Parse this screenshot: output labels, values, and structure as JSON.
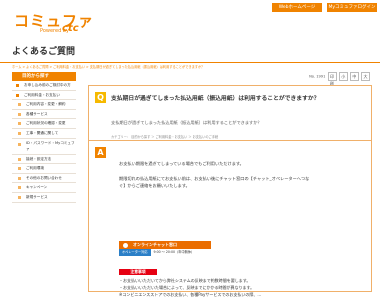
{
  "header": {
    "logo": "コミュファ",
    "logo_sub": "Powered by",
    "logo_brand": "ctc",
    "links": [
      "Webホームページ",
      "Myコミュファログイン"
    ]
  },
  "page_title": "よくあるご質問",
  "breadcrumb": "ホーム > よくあるご質問 > ご利用料金・お支払い > 支払期日が過ぎてしまった払込用紙（振込用紙）は利用することができますか？",
  "sidebar": {
    "heading": "目的から探す",
    "items": [
      "お申し込み前のご検討中の方",
      "ご利用料金・お支払い",
      "ご利用内容・変更・解約",
      "各種サービス",
      "ご利用状況の確認・変更",
      "工事・開通に関して",
      "ID・パスワード・Myコミュファ",
      "接続・設定方法",
      "ご利用環境",
      "その他のお問い合わせ",
      "キャンペーン",
      "新規サービス"
    ]
  },
  "toolbar": {
    "label": "No. 1991",
    "print": "印刷",
    "size_a": "小",
    "size_b": "中",
    "size_c": "大"
  },
  "question": {
    "badge": "Q",
    "title": "支払期日が過ぎてしまった払込用紙（振込用紙）は利用することができますか？",
    "text": "支払期日が過ぎてしまった払込用紙（振込用紙）は利用することができますか？",
    "category": "カテゴリー： 目的から探す ＞ ご利用料金・お支払い ＞ お支払いのご手続"
  },
  "answer": {
    "badge": "A",
    "lines": [
      "お支払い期限を過ぎてしまっている場合でもご利用いただけます。",
      "期限切れの払込用紙にてお支払い前は、お支払い後にチャット窓口の【チャット_オペレーターへつな",
      "ぐ】からご連絡をお願いいたします。"
    ],
    "chat_title": "オンラインチャット窓口",
    "chat_sub": "オペレーター対応",
    "chat_hours": "9:00 〜 20:00（年中無休）",
    "warning_label": "注意事項",
    "warnings": [
      "・お支払いいただいてから弊社システムの反映まで約数時間を要します。",
      "・お支払いいただいた場合によって、反映までにかかる時間が異なります。",
      "※コンビニエンスストアでのお支払い、各種Payサービスでのお支払いの際、..."
    ]
  }
}
